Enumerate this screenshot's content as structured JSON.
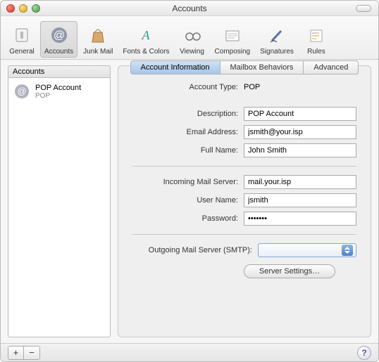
{
  "window": {
    "title": "Accounts"
  },
  "toolbar": {
    "items": [
      {
        "label": "General"
      },
      {
        "label": "Accounts"
      },
      {
        "label": "Junk Mail"
      },
      {
        "label": "Fonts & Colors"
      },
      {
        "label": "Viewing"
      },
      {
        "label": "Composing"
      },
      {
        "label": "Signatures"
      },
      {
        "label": "Rules"
      }
    ]
  },
  "sidebar": {
    "header": "Accounts",
    "accounts": [
      {
        "name": "POP Account",
        "sub": "POP"
      }
    ]
  },
  "tabs": {
    "items": [
      {
        "label": "Account Information"
      },
      {
        "label": "Mailbox Behaviors"
      },
      {
        "label": "Advanced"
      }
    ]
  },
  "form": {
    "accountTypeLabel": "Account Type:",
    "accountTypeValue": "POP",
    "descriptionLabel": "Description:",
    "descriptionValue": "POP Account",
    "emailLabel": "Email Address:",
    "emailValue": "jsmith@your.isp",
    "fullNameLabel": "Full Name:",
    "fullNameValue": "John Smith",
    "incomingLabel": "Incoming Mail Server:",
    "incomingValue": "mail.your.isp",
    "userLabel": "User Name:",
    "userValue": "jsmith",
    "passwordLabel": "Password:",
    "passwordValue": "•••••••",
    "smtpLabel": "Outgoing Mail Server (SMTP):",
    "smtpValue": "",
    "serverSettingsLabel": "Server Settings…"
  },
  "footer": {
    "add": "+",
    "remove": "−",
    "help": "?"
  }
}
